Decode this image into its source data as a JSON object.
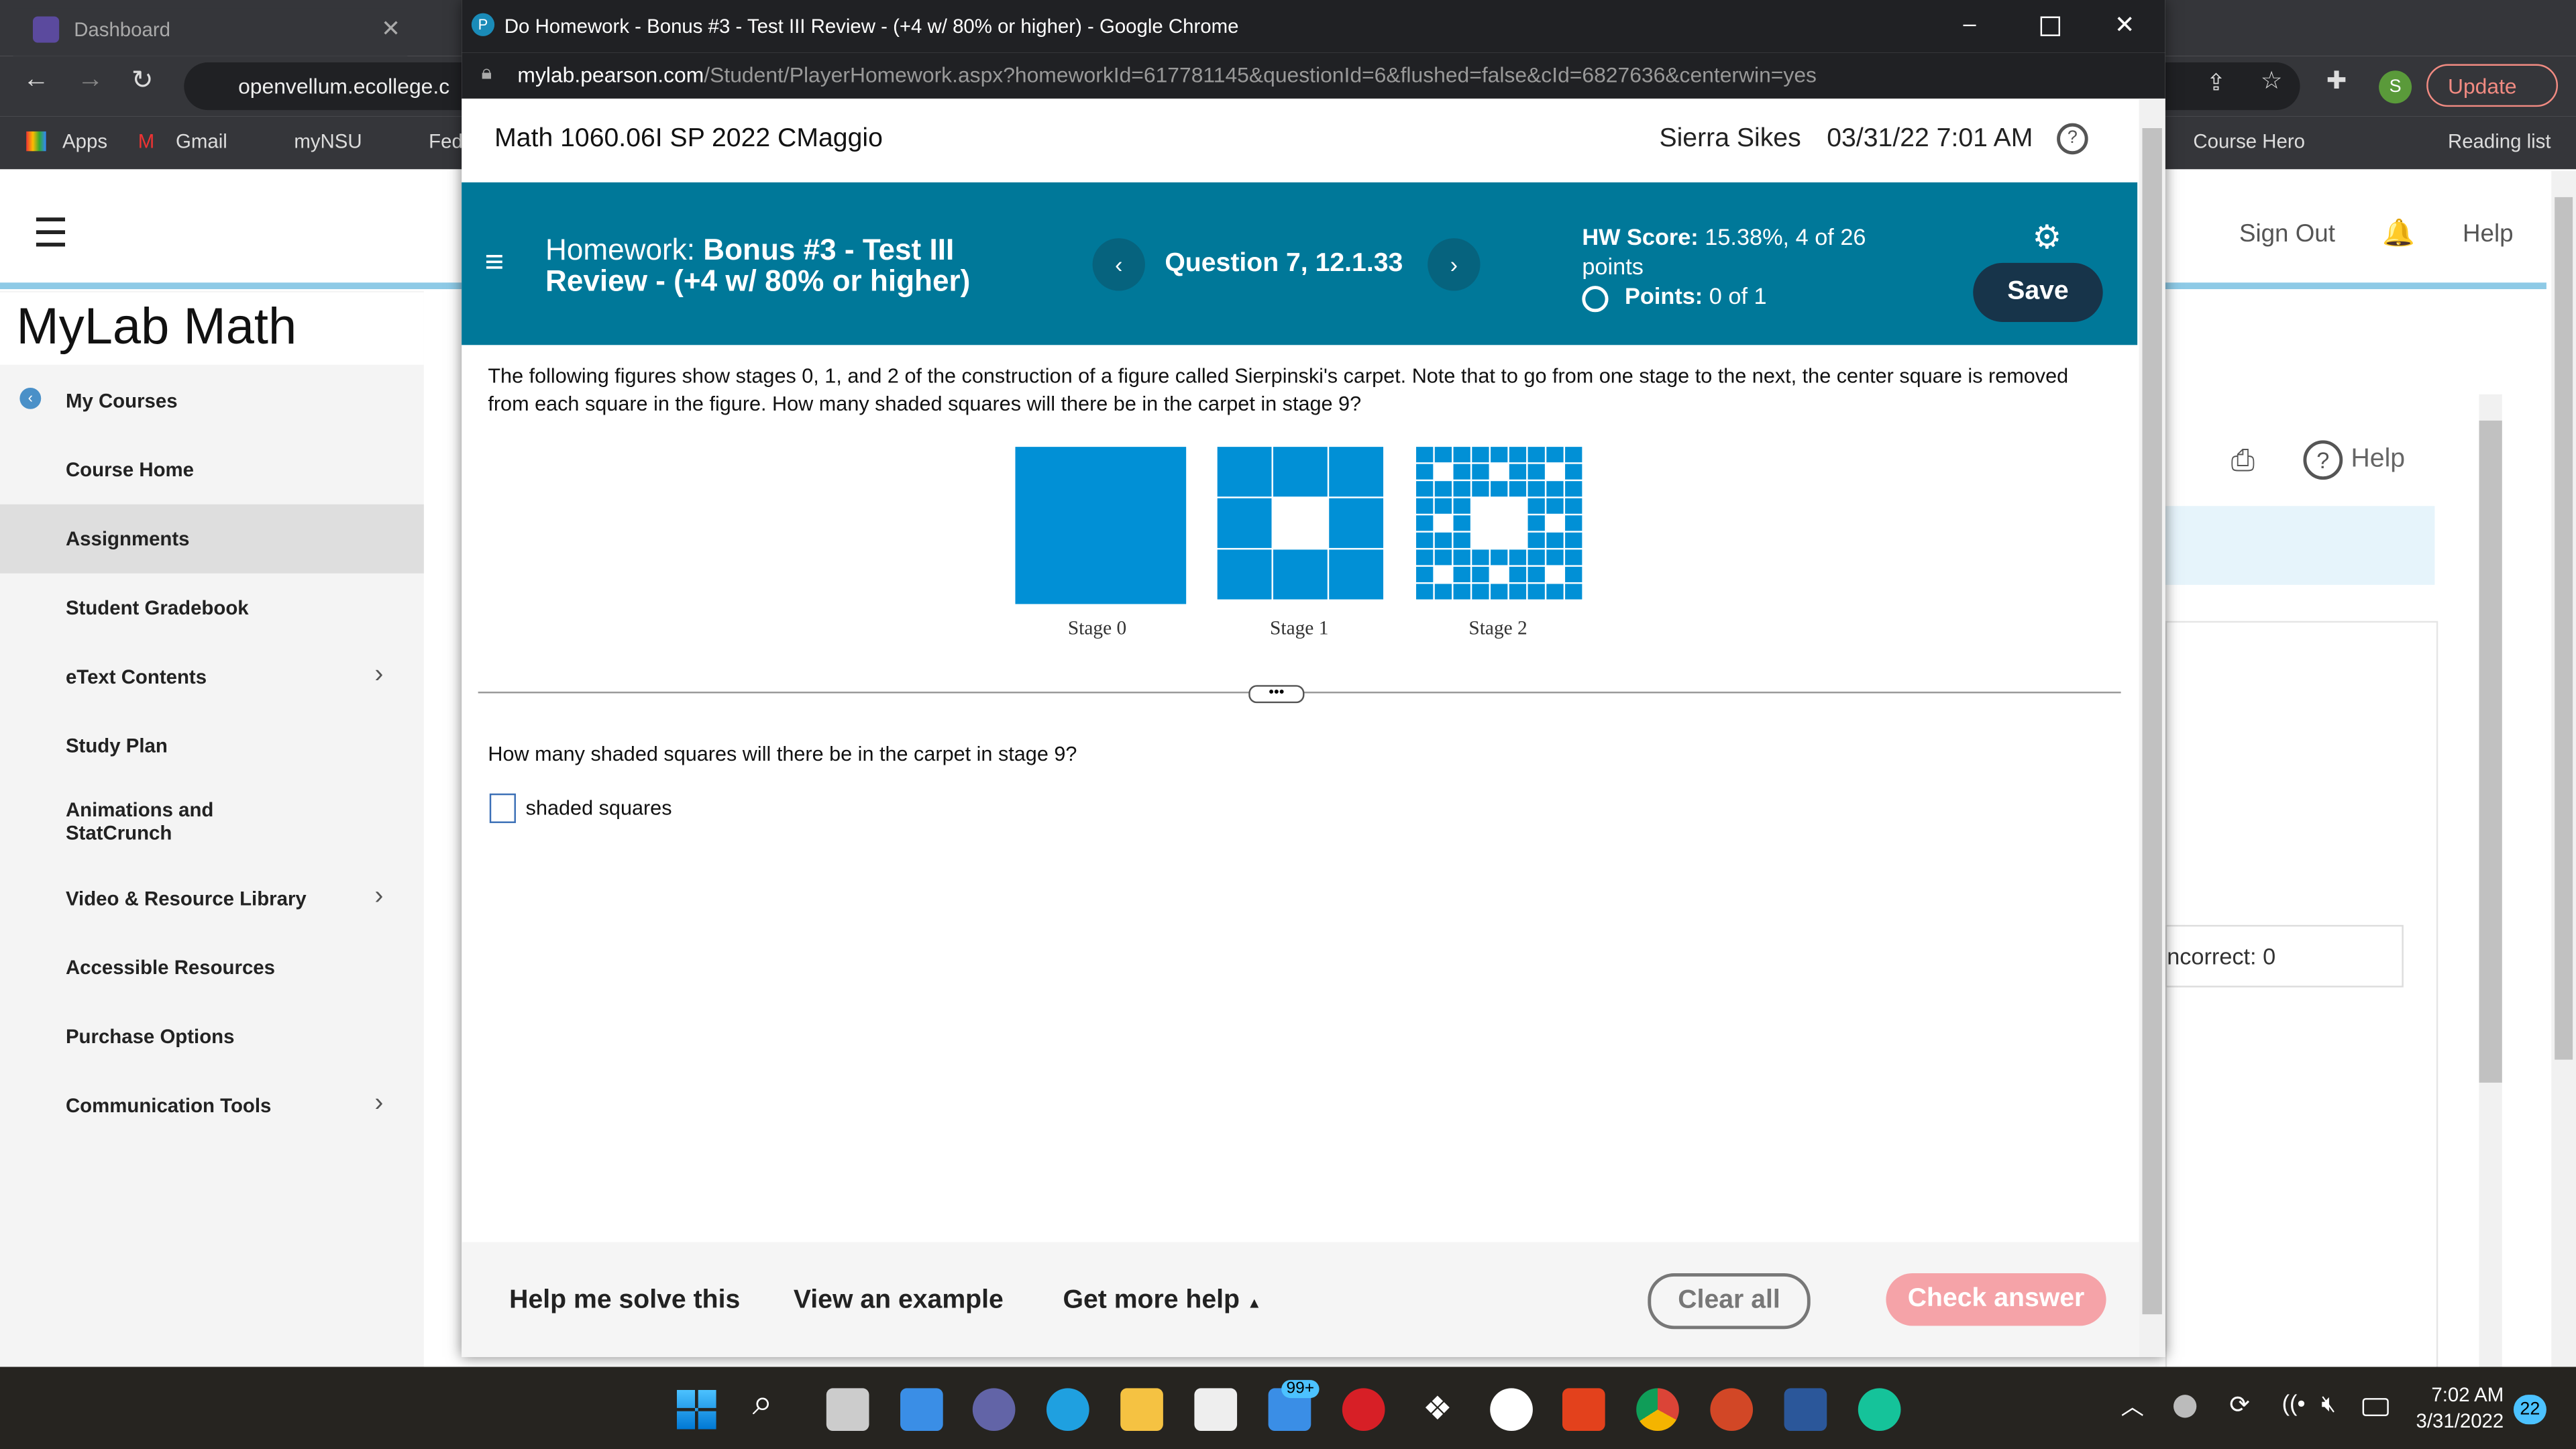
{
  "browser_back": {
    "tab": "Dashboard",
    "url": "openvellum.ecollege.c",
    "bookmarks": [
      "Apps",
      "Gmail",
      "myNSU",
      "Fed"
    ],
    "right_bookmarks": [
      "Course Hero",
      "Reading list"
    ],
    "update": "Update",
    "profile": "S"
  },
  "bg_page": {
    "logo": "MyLab Math",
    "sign_out": "Sign Out",
    "help": "Help",
    "help2": "Help",
    "incorrect": "ncorrect: 0",
    "sidebar": [
      {
        "label": "My Courses"
      },
      {
        "label": "Course Home"
      },
      {
        "label": "Assignments"
      },
      {
        "label": "Student Gradebook"
      },
      {
        "label": "eText Contents"
      },
      {
        "label": "Study Plan"
      },
      {
        "label": "Animations and StatCrunch"
      },
      {
        "label": "Video & Resource Library"
      },
      {
        "label": "Accessible Resources"
      },
      {
        "label": "Purchase Options"
      },
      {
        "label": "Communication Tools"
      }
    ]
  },
  "popup": {
    "window_title": "Do Homework - Bonus #3 - Test III Review - (+4 w/ 80% or higher) - Google Chrome",
    "url_host": "mylab.pearson.com",
    "url_path": "/Student/PlayerHomework.aspx?homeworkId=617781145&questionId=6&flushed=false&cId=6827636&centerwin=yes",
    "course": "Math 1060.06I SP 2022 CMaggio",
    "user": "Sierra Sikes",
    "datetime": "03/31/22 7:01 AM",
    "hw_label": "Homework:",
    "hw_name": "Bonus #3 - Test III Review - (+4 w/ 80% or higher)",
    "question": "Question 7, 12.1.33",
    "score_label": "HW Score:",
    "score_value": "15.38%, 4 of 26 points",
    "points_label": "Points:",
    "points_value": "0 of 1",
    "save": "Save",
    "problem": "The following figures show stages 0, 1, and 2 of the construction of a figure called Sierpinski's carpet. Note that to go from one stage to the next, the center square is removed from each square in the figure. How many shaded squares will there be in the carpet in stage 9?",
    "stages": [
      "Stage 0",
      "Stage 1",
      "Stage 2"
    ],
    "prompt": "How many shaded squares will there be in the carpet in stage 9?",
    "answer_value": "",
    "answer_suffix": "shaded squares",
    "footer": {
      "help_solve": "Help me solve this",
      "example": "View an example",
      "more_help": "Get more help",
      "clear": "Clear all",
      "check": "Check answer"
    },
    "accent": "#007899",
    "figure_color": "#0190d6"
  },
  "taskbar": {
    "time": "7:02 AM",
    "date": "3/31/2022",
    "notifications": "22",
    "mail_badge": "99+"
  }
}
